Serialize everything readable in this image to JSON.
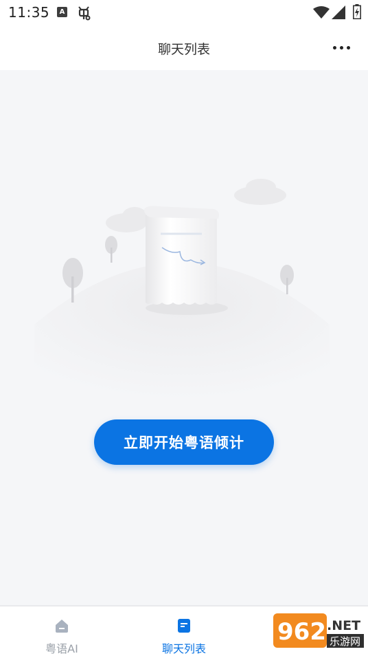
{
  "status_bar": {
    "time": "11:35",
    "icons": [
      "a-icon",
      "bug-icon",
      "wifi-icon",
      "signal-icon",
      "battery-icon"
    ],
    "a_icon_glyph": "A"
  },
  "header": {
    "title": "聊天列表",
    "more_icon": "more-dots-icon"
  },
  "main": {
    "illustration": "empty-state-illustration",
    "start_button_label": "立即开始粤语倾计"
  },
  "tabs": [
    {
      "label": "粤语AI",
      "icon": "home-icon",
      "active": false
    },
    {
      "label": "聊天列表",
      "icon": "chat-list-icon",
      "active": true
    },
    {
      "label": "",
      "icon": "profile-icon",
      "active": false
    }
  ],
  "watermark": {
    "main_text": "962",
    "suffix": ".NET",
    "sub_text": "乐游网"
  },
  "colors": {
    "accent": "#0b74e3",
    "background": "#f5f6f8",
    "inactive_tab": "#9aa0a8",
    "watermark_orange": "#f28a1f"
  }
}
